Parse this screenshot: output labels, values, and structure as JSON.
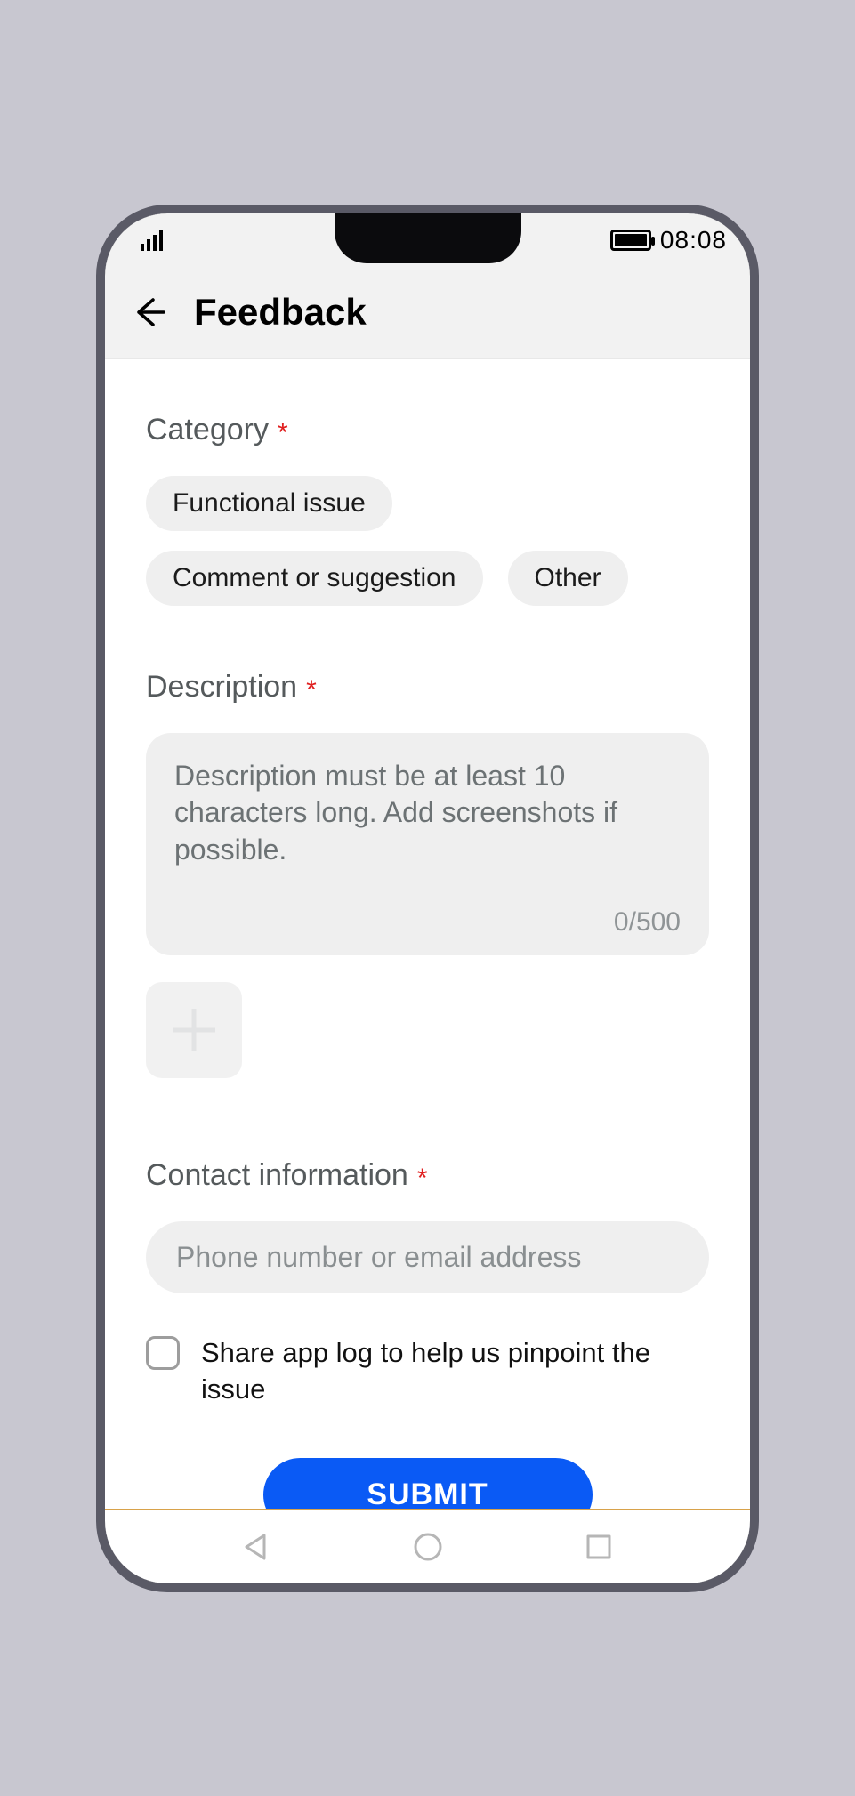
{
  "status": {
    "time": "08:08"
  },
  "header": {
    "title": "Feedback"
  },
  "category": {
    "label": "Category",
    "chips": [
      "Functional issue",
      "Comment or suggestion",
      "Other"
    ]
  },
  "description": {
    "label": "Description",
    "placeholder": "Description must be at least 10 characters long. Add screenshots if possible.",
    "value": "",
    "counter": "0/500"
  },
  "contact": {
    "label": "Contact information",
    "placeholder": "Phone number or email address",
    "value": ""
  },
  "share_log": {
    "label": "Share app log to help us pinpoint the issue",
    "checked": false
  },
  "submit_label": "SUBMIT"
}
